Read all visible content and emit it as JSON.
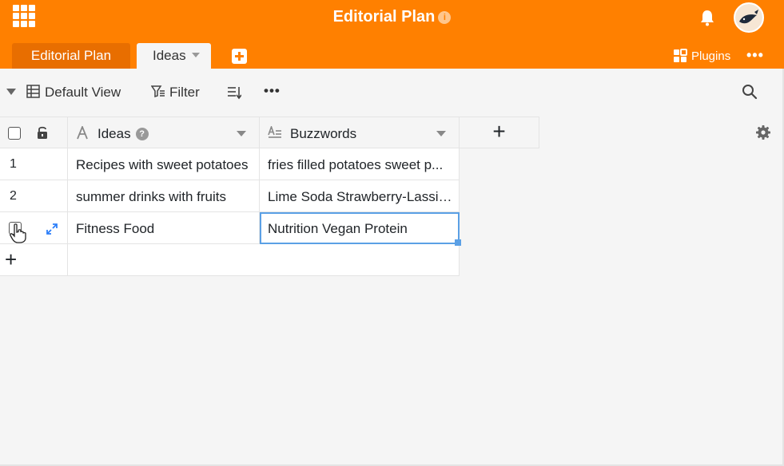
{
  "header": {
    "base_title": "Editorial Plan",
    "info_icon": "i",
    "tabs": [
      {
        "label": "Editorial Plan",
        "active": false
      },
      {
        "label": "Ideas",
        "active": true
      }
    ],
    "plugins_label": "Plugins",
    "more_label": "•••"
  },
  "toolbar": {
    "view_label": "Default View",
    "filter_label": "Filter",
    "more_label": "•••"
  },
  "table": {
    "columns": [
      {
        "name": "Ideas",
        "help": "?"
      },
      {
        "name": "Buzzwords"
      }
    ],
    "add_column_label": "+",
    "rows": [
      {
        "num": "1",
        "ideas": "Recipes with sweet potatoes",
        "buzzwords": "fries filled potatoes sweet p..."
      },
      {
        "num": "2",
        "ideas": "summer drinks with fruits",
        "buzzwords": "Lime Soda Strawberry-Lassi ..."
      },
      {
        "num": "",
        "ideas": "Fitness Food",
        "buzzwords": "Nutrition Vegan Protein"
      }
    ],
    "add_row_label": "+"
  },
  "colors": {
    "brand": "#ff8000",
    "tab_dark": "#e86e00",
    "selection": "#5ba0e5",
    "expand_icon": "#2d7ff9"
  }
}
